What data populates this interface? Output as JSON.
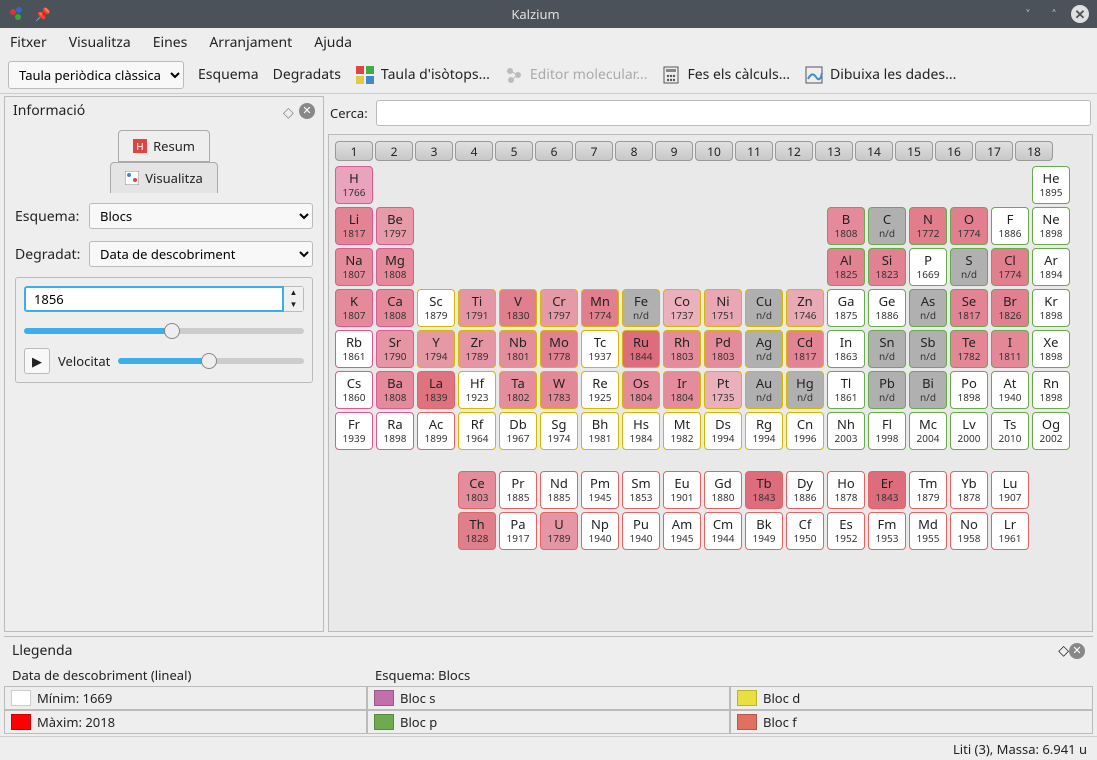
{
  "window": {
    "title": "Kalzium"
  },
  "menubar": [
    "Fitxer",
    "Visualitza",
    "Eines",
    "Arranjament",
    "Ajuda"
  ],
  "toolbar": {
    "table_dropdown": "Taula periòdica clàssica",
    "scheme": "Esquema",
    "gradients": "Degradats",
    "isotope": "Taula d'isòtops...",
    "moleditor": "Editor molecular...",
    "calc": "Fes els càlculs...",
    "plot": "Dibuixa les dades..."
  },
  "left": {
    "title": "Informació",
    "tab_summary": "Resum",
    "tab_view": "Visualitza",
    "scheme_label": "Esquema:",
    "scheme_value": "Blocs",
    "gradient_label": "Degradat:",
    "gradient_value": "Data de descobriment",
    "year_value": "1856",
    "velocity_label": "Velocitat"
  },
  "search_label": "Cerca:",
  "legend": {
    "title": "Llegenda",
    "grad_title": "Data de descobriment (lineal)",
    "scheme_title": "Esquema: Blocs",
    "min": "Mínim: 1669",
    "max": "Màxim: 2018",
    "bloc_s": "Bloc s",
    "bloc_p": "Bloc p",
    "bloc_d": "Bloc d",
    "bloc_f": "Bloc f",
    "colors": {
      "min": "#ffffff",
      "max": "#ff0000",
      "s": "#c070aa",
      "p": "#70aa50",
      "d": "#e8e040",
      "f": "#e07060"
    }
  },
  "statusbar": "Liti (3), Massa: 6.941 u",
  "groups": [
    "1",
    "2",
    "3",
    "4",
    "5",
    "6",
    "7",
    "8",
    "9",
    "10",
    "11",
    "12",
    "13",
    "14",
    "15",
    "16",
    "17",
    "18"
  ],
  "elements": [
    {
      "r": 1,
      "c": 1,
      "sym": "H",
      "yr": "1766",
      "bg": "#eaa3bc",
      "blk": "s"
    },
    {
      "r": 1,
      "c": 18,
      "sym": "He",
      "yr": "1895",
      "bg": "#ffffff",
      "blk": "p"
    },
    {
      "r": 2,
      "c": 1,
      "sym": "Li",
      "yr": "1817",
      "bg": "#e38495",
      "blk": "s"
    },
    {
      "r": 2,
      "c": 2,
      "sym": "Be",
      "yr": "1797",
      "bg": "#e79aa8",
      "blk": "s"
    },
    {
      "r": 2,
      "c": 13,
      "sym": "B",
      "yr": "1808",
      "bg": "#e48a9a",
      "blk": "p"
    },
    {
      "r": 2,
      "c": 14,
      "sym": "C",
      "yr": "n/d",
      "bg": "#b0b0b0",
      "blk": "p"
    },
    {
      "r": 2,
      "c": 15,
      "sym": "N",
      "yr": "1772",
      "bg": "#e27d8c",
      "blk": "p"
    },
    {
      "r": 2,
      "c": 16,
      "sym": "O",
      "yr": "1774",
      "bg": "#e27f8e",
      "blk": "p"
    },
    {
      "r": 2,
      "c": 17,
      "sym": "F",
      "yr": "1886",
      "bg": "#ffffff",
      "blk": "p"
    },
    {
      "r": 2,
      "c": 18,
      "sym": "Ne",
      "yr": "1898",
      "bg": "#ffffff",
      "blk": "p"
    },
    {
      "r": 3,
      "c": 1,
      "sym": "Na",
      "yr": "1807",
      "bg": "#e48a9a",
      "blk": "s"
    },
    {
      "r": 3,
      "c": 2,
      "sym": "Mg",
      "yr": "1808",
      "bg": "#e48a9a",
      "blk": "s"
    },
    {
      "r": 3,
      "c": 13,
      "sym": "Al",
      "yr": "1825",
      "bg": "#e28293",
      "blk": "p"
    },
    {
      "r": 3,
      "c": 14,
      "sym": "Si",
      "yr": "1823",
      "bg": "#e28192",
      "blk": "p"
    },
    {
      "r": 3,
      "c": 15,
      "sym": "P",
      "yr": "1669",
      "bg": "#ffffff",
      "blk": "p"
    },
    {
      "r": 3,
      "c": 16,
      "sym": "S",
      "yr": "n/d",
      "bg": "#b0b0b0",
      "blk": "p"
    },
    {
      "r": 3,
      "c": 17,
      "sym": "Cl",
      "yr": "1774",
      "bg": "#e27f8e",
      "blk": "p"
    },
    {
      "r": 3,
      "c": 18,
      "sym": "Ar",
      "yr": "1894",
      "bg": "#ffffff",
      "blk": "p"
    },
    {
      "r": 4,
      "c": 1,
      "sym": "K",
      "yr": "1807",
      "bg": "#e48a9a",
      "blk": "s"
    },
    {
      "r": 4,
      "c": 2,
      "sym": "Ca",
      "yr": "1808",
      "bg": "#e48a9a",
      "blk": "s"
    },
    {
      "r": 4,
      "c": 3,
      "sym": "Sc",
      "yr": "1879",
      "bg": "#ffffff",
      "blk": "d"
    },
    {
      "r": 4,
      "c": 4,
      "sym": "Ti",
      "yr": "1791",
      "bg": "#e596a4",
      "blk": "d"
    },
    {
      "r": 4,
      "c": 5,
      "sym": "V",
      "yr": "1830",
      "bg": "#e07f8e",
      "blk": "d"
    },
    {
      "r": 4,
      "c": 6,
      "sym": "Cr",
      "yr": "1797",
      "bg": "#e69aa8",
      "blk": "d"
    },
    {
      "r": 4,
      "c": 7,
      "sym": "Mn",
      "yr": "1774",
      "bg": "#e27f8e",
      "blk": "d"
    },
    {
      "r": 4,
      "c": 8,
      "sym": "Fe",
      "yr": "n/d",
      "bg": "#b0b0b0",
      "blk": "d"
    },
    {
      "r": 4,
      "c": 9,
      "sym": "Co",
      "yr": "1737",
      "bg": "#eab0bb",
      "blk": "d"
    },
    {
      "r": 4,
      "c": 10,
      "sym": "Ni",
      "yr": "1751",
      "bg": "#e8a7b3",
      "blk": "d"
    },
    {
      "r": 4,
      "c": 11,
      "sym": "Cu",
      "yr": "n/d",
      "bg": "#b0b0b0",
      "blk": "d"
    },
    {
      "r": 4,
      "c": 12,
      "sym": "Zn",
      "yr": "1746",
      "bg": "#e9aab5",
      "blk": "d"
    },
    {
      "r": 4,
      "c": 13,
      "sym": "Ga",
      "yr": "1875",
      "bg": "#ffffff",
      "blk": "p"
    },
    {
      "r": 4,
      "c": 14,
      "sym": "Ge",
      "yr": "1886",
      "bg": "#ffffff",
      "blk": "p"
    },
    {
      "r": 4,
      "c": 15,
      "sym": "As",
      "yr": "n/d",
      "bg": "#b0b0b0",
      "blk": "p"
    },
    {
      "r": 4,
      "c": 16,
      "sym": "Se",
      "yr": "1817",
      "bg": "#e38495",
      "blk": "p"
    },
    {
      "r": 4,
      "c": 17,
      "sym": "Br",
      "yr": "1826",
      "bg": "#e18091",
      "blk": "p"
    },
    {
      "r": 4,
      "c": 18,
      "sym": "Kr",
      "yr": "1898",
      "bg": "#ffffff",
      "blk": "p"
    },
    {
      "r": 5,
      "c": 1,
      "sym": "Rb",
      "yr": "1861",
      "bg": "#ffffff",
      "blk": "s"
    },
    {
      "r": 5,
      "c": 2,
      "sym": "Sr",
      "yr": "1790",
      "bg": "#e595a3",
      "blk": "s"
    },
    {
      "r": 5,
      "c": 3,
      "sym": "Y",
      "yr": "1794",
      "bg": "#e698a5",
      "blk": "d"
    },
    {
      "r": 5,
      "c": 4,
      "sym": "Zr",
      "yr": "1789",
      "bg": "#e595a3",
      "blk": "d"
    },
    {
      "r": 5,
      "c": 5,
      "sym": "Nb",
      "yr": "1801",
      "bg": "#e48e9d",
      "blk": "d"
    },
    {
      "r": 5,
      "c": 6,
      "sym": "Mo",
      "yr": "1778",
      "bg": "#e28192",
      "blk": "d"
    },
    {
      "r": 5,
      "c": 7,
      "sym": "Tc",
      "yr": "1937",
      "bg": "#ffffff",
      "blk": "d"
    },
    {
      "r": 5,
      "c": 8,
      "sym": "Ru",
      "yr": "1844",
      "bg": "#dd6c7c",
      "blk": "d"
    },
    {
      "r": 5,
      "c": 9,
      "sym": "Rh",
      "yr": "1803",
      "bg": "#e48c9b",
      "blk": "d"
    },
    {
      "r": 5,
      "c": 10,
      "sym": "Pd",
      "yr": "1803",
      "bg": "#e48c9b",
      "blk": "d"
    },
    {
      "r": 5,
      "c": 11,
      "sym": "Ag",
      "yr": "n/d",
      "bg": "#b0b0b0",
      "blk": "d"
    },
    {
      "r": 5,
      "c": 12,
      "sym": "Cd",
      "yr": "1817",
      "bg": "#e38495",
      "blk": "d"
    },
    {
      "r": 5,
      "c": 13,
      "sym": "In",
      "yr": "1863",
      "bg": "#ffffff",
      "blk": "p"
    },
    {
      "r": 5,
      "c": 14,
      "sym": "Sn",
      "yr": "n/d",
      "bg": "#b0b0b0",
      "blk": "p"
    },
    {
      "r": 5,
      "c": 15,
      "sym": "Sb",
      "yr": "n/d",
      "bg": "#b0b0b0",
      "blk": "p"
    },
    {
      "r": 5,
      "c": 16,
      "sym": "Te",
      "yr": "1782",
      "bg": "#e38796",
      "blk": "p"
    },
    {
      "r": 5,
      "c": 17,
      "sym": "I",
      "yr": "1811",
      "bg": "#e48797",
      "blk": "p"
    },
    {
      "r": 5,
      "c": 18,
      "sym": "Xe",
      "yr": "1898",
      "bg": "#ffffff",
      "blk": "p"
    },
    {
      "r": 6,
      "c": 1,
      "sym": "Cs",
      "yr": "1860",
      "bg": "#ffffff",
      "blk": "s"
    },
    {
      "r": 6,
      "c": 2,
      "sym": "Ba",
      "yr": "1808",
      "bg": "#e48a9a",
      "blk": "s"
    },
    {
      "r": 6,
      "c": 3,
      "sym": "La",
      "yr": "1839",
      "bg": "#de737f",
      "blk": "f"
    },
    {
      "r": 6,
      "c": 4,
      "sym": "Hf",
      "yr": "1923",
      "bg": "#ffffff",
      "blk": "d"
    },
    {
      "r": 6,
      "c": 5,
      "sym": "Ta",
      "yr": "1802",
      "bg": "#e48d9c",
      "blk": "d"
    },
    {
      "r": 6,
      "c": 6,
      "sym": "W",
      "yr": "1783",
      "bg": "#e38897",
      "blk": "d"
    },
    {
      "r": 6,
      "c": 7,
      "sym": "Re",
      "yr": "1925",
      "bg": "#ffffff",
      "blk": "d"
    },
    {
      "r": 6,
      "c": 8,
      "sym": "Os",
      "yr": "1804",
      "bg": "#e48c9b",
      "blk": "d"
    },
    {
      "r": 6,
      "c": 9,
      "sym": "Ir",
      "yr": "1804",
      "bg": "#e48c9b",
      "blk": "d"
    },
    {
      "r": 6,
      "c": 10,
      "sym": "Pt",
      "yr": "1735",
      "bg": "#eab1bc",
      "blk": "d"
    },
    {
      "r": 6,
      "c": 11,
      "sym": "Au",
      "yr": "n/d",
      "bg": "#b0b0b0",
      "blk": "d"
    },
    {
      "r": 6,
      "c": 12,
      "sym": "Hg",
      "yr": "n/d",
      "bg": "#b0b0b0",
      "blk": "d"
    },
    {
      "r": 6,
      "c": 13,
      "sym": "Tl",
      "yr": "1861",
      "bg": "#ffffff",
      "blk": "p"
    },
    {
      "r": 6,
      "c": 14,
      "sym": "Pb",
      "yr": "n/d",
      "bg": "#b0b0b0",
      "blk": "p"
    },
    {
      "r": 6,
      "c": 15,
      "sym": "Bi",
      "yr": "n/d",
      "bg": "#b0b0b0",
      "blk": "p"
    },
    {
      "r": 6,
      "c": 16,
      "sym": "Po",
      "yr": "1898",
      "bg": "#ffffff",
      "blk": "p"
    },
    {
      "r": 6,
      "c": 17,
      "sym": "At",
      "yr": "1940",
      "bg": "#ffffff",
      "blk": "p"
    },
    {
      "r": 6,
      "c": 18,
      "sym": "Rn",
      "yr": "1898",
      "bg": "#ffffff",
      "blk": "p"
    },
    {
      "r": 7,
      "c": 1,
      "sym": "Fr",
      "yr": "1939",
      "bg": "#ffffff",
      "blk": "s"
    },
    {
      "r": 7,
      "c": 2,
      "sym": "Ra",
      "yr": "1898",
      "bg": "#ffffff",
      "blk": "s"
    },
    {
      "r": 7,
      "c": 3,
      "sym": "Ac",
      "yr": "1899",
      "bg": "#ffffff",
      "blk": "f"
    },
    {
      "r": 7,
      "c": 4,
      "sym": "Rf",
      "yr": "1964",
      "bg": "#ffffff",
      "blk": "d"
    },
    {
      "r": 7,
      "c": 5,
      "sym": "Db",
      "yr": "1967",
      "bg": "#ffffff",
      "blk": "d"
    },
    {
      "r": 7,
      "c": 6,
      "sym": "Sg",
      "yr": "1974",
      "bg": "#ffffff",
      "blk": "d"
    },
    {
      "r": 7,
      "c": 7,
      "sym": "Bh",
      "yr": "1981",
      "bg": "#ffffff",
      "blk": "d"
    },
    {
      "r": 7,
      "c": 8,
      "sym": "Hs",
      "yr": "1984",
      "bg": "#ffffff",
      "blk": "d"
    },
    {
      "r": 7,
      "c": 9,
      "sym": "Mt",
      "yr": "1982",
      "bg": "#ffffff",
      "blk": "d"
    },
    {
      "r": 7,
      "c": 10,
      "sym": "Ds",
      "yr": "1994",
      "bg": "#ffffff",
      "blk": "d"
    },
    {
      "r": 7,
      "c": 11,
      "sym": "Rg",
      "yr": "1994",
      "bg": "#ffffff",
      "blk": "d"
    },
    {
      "r": 7,
      "c": 12,
      "sym": "Cn",
      "yr": "1996",
      "bg": "#ffffff",
      "blk": "d"
    },
    {
      "r": 7,
      "c": 13,
      "sym": "Nh",
      "yr": "2003",
      "bg": "#ffffff",
      "blk": "p"
    },
    {
      "r": 7,
      "c": 14,
      "sym": "Fl",
      "yr": "1998",
      "bg": "#ffffff",
      "blk": "p"
    },
    {
      "r": 7,
      "c": 15,
      "sym": "Mc",
      "yr": "2004",
      "bg": "#ffffff",
      "blk": "p"
    },
    {
      "r": 7,
      "c": 16,
      "sym": "Lv",
      "yr": "2000",
      "bg": "#ffffff",
      "blk": "p"
    },
    {
      "r": 7,
      "c": 17,
      "sym": "Ts",
      "yr": "2010",
      "bg": "#ffffff",
      "blk": "p"
    },
    {
      "r": 7,
      "c": 18,
      "sym": "Og",
      "yr": "2002",
      "bg": "#ffffff",
      "blk": "p"
    },
    {
      "r": 8,
      "c": 4,
      "sym": "Ce",
      "yr": "1803",
      "bg": "#e48c9b",
      "blk": "f"
    },
    {
      "r": 8,
      "c": 5,
      "sym": "Pr",
      "yr": "1885",
      "bg": "#ffffff",
      "blk": "f"
    },
    {
      "r": 8,
      "c": 6,
      "sym": "Nd",
      "yr": "1885",
      "bg": "#ffffff",
      "blk": "f"
    },
    {
      "r": 8,
      "c": 7,
      "sym": "Pm",
      "yr": "1945",
      "bg": "#ffffff",
      "blk": "f"
    },
    {
      "r": 8,
      "c": 8,
      "sym": "Sm",
      "yr": "1853",
      "bg": "#ffffff",
      "blk": "f"
    },
    {
      "r": 8,
      "c": 9,
      "sym": "Eu",
      "yr": "1901",
      "bg": "#ffffff",
      "blk": "f"
    },
    {
      "r": 8,
      "c": 10,
      "sym": "Gd",
      "yr": "1880",
      "bg": "#ffffff",
      "blk": "f"
    },
    {
      "r": 8,
      "c": 11,
      "sym": "Tb",
      "yr": "1843",
      "bg": "#dd6c7c",
      "blk": "f"
    },
    {
      "r": 8,
      "c": 12,
      "sym": "Dy",
      "yr": "1886",
      "bg": "#ffffff",
      "blk": "f"
    },
    {
      "r": 8,
      "c": 13,
      "sym": "Ho",
      "yr": "1878",
      "bg": "#ffffff",
      "blk": "f"
    },
    {
      "r": 8,
      "c": 14,
      "sym": "Er",
      "yr": "1843",
      "bg": "#dd6c7c",
      "blk": "f"
    },
    {
      "r": 8,
      "c": 15,
      "sym": "Tm",
      "yr": "1879",
      "bg": "#ffffff",
      "blk": "f"
    },
    {
      "r": 8,
      "c": 16,
      "sym": "Yb",
      "yr": "1878",
      "bg": "#ffffff",
      "blk": "f"
    },
    {
      "r": 8,
      "c": 17,
      "sym": "Lu",
      "yr": "1907",
      "bg": "#ffffff",
      "blk": "f"
    },
    {
      "r": 9,
      "c": 4,
      "sym": "Th",
      "yr": "1828",
      "bg": "#e07f8c",
      "blk": "f"
    },
    {
      "r": 9,
      "c": 5,
      "sym": "Pa",
      "yr": "1917",
      "bg": "#ffffff",
      "blk": "f"
    },
    {
      "r": 9,
      "c": 6,
      "sym": "U",
      "yr": "1789",
      "bg": "#e595a3",
      "blk": "f"
    },
    {
      "r": 9,
      "c": 7,
      "sym": "Np",
      "yr": "1940",
      "bg": "#ffffff",
      "blk": "f"
    },
    {
      "r": 9,
      "c": 8,
      "sym": "Pu",
      "yr": "1940",
      "bg": "#ffffff",
      "blk": "f"
    },
    {
      "r": 9,
      "c": 9,
      "sym": "Am",
      "yr": "1945",
      "bg": "#ffffff",
      "blk": "f"
    },
    {
      "r": 9,
      "c": 10,
      "sym": "Cm",
      "yr": "1944",
      "bg": "#ffffff",
      "blk": "f"
    },
    {
      "r": 9,
      "c": 11,
      "sym": "Bk",
      "yr": "1949",
      "bg": "#ffffff",
      "blk": "f"
    },
    {
      "r": 9,
      "c": 12,
      "sym": "Cf",
      "yr": "1950",
      "bg": "#ffffff",
      "blk": "f"
    },
    {
      "r": 9,
      "c": 13,
      "sym": "Es",
      "yr": "1952",
      "bg": "#ffffff",
      "blk": "f"
    },
    {
      "r": 9,
      "c": 14,
      "sym": "Fm",
      "yr": "1953",
      "bg": "#ffffff",
      "blk": "f"
    },
    {
      "r": 9,
      "c": 15,
      "sym": "Md",
      "yr": "1955",
      "bg": "#ffffff",
      "blk": "f"
    },
    {
      "r": 9,
      "c": 16,
      "sym": "No",
      "yr": "1958",
      "bg": "#ffffff",
      "blk": "f"
    },
    {
      "r": 9,
      "c": 17,
      "sym": "Lr",
      "yr": "1961",
      "bg": "#ffffff",
      "blk": "f"
    }
  ]
}
